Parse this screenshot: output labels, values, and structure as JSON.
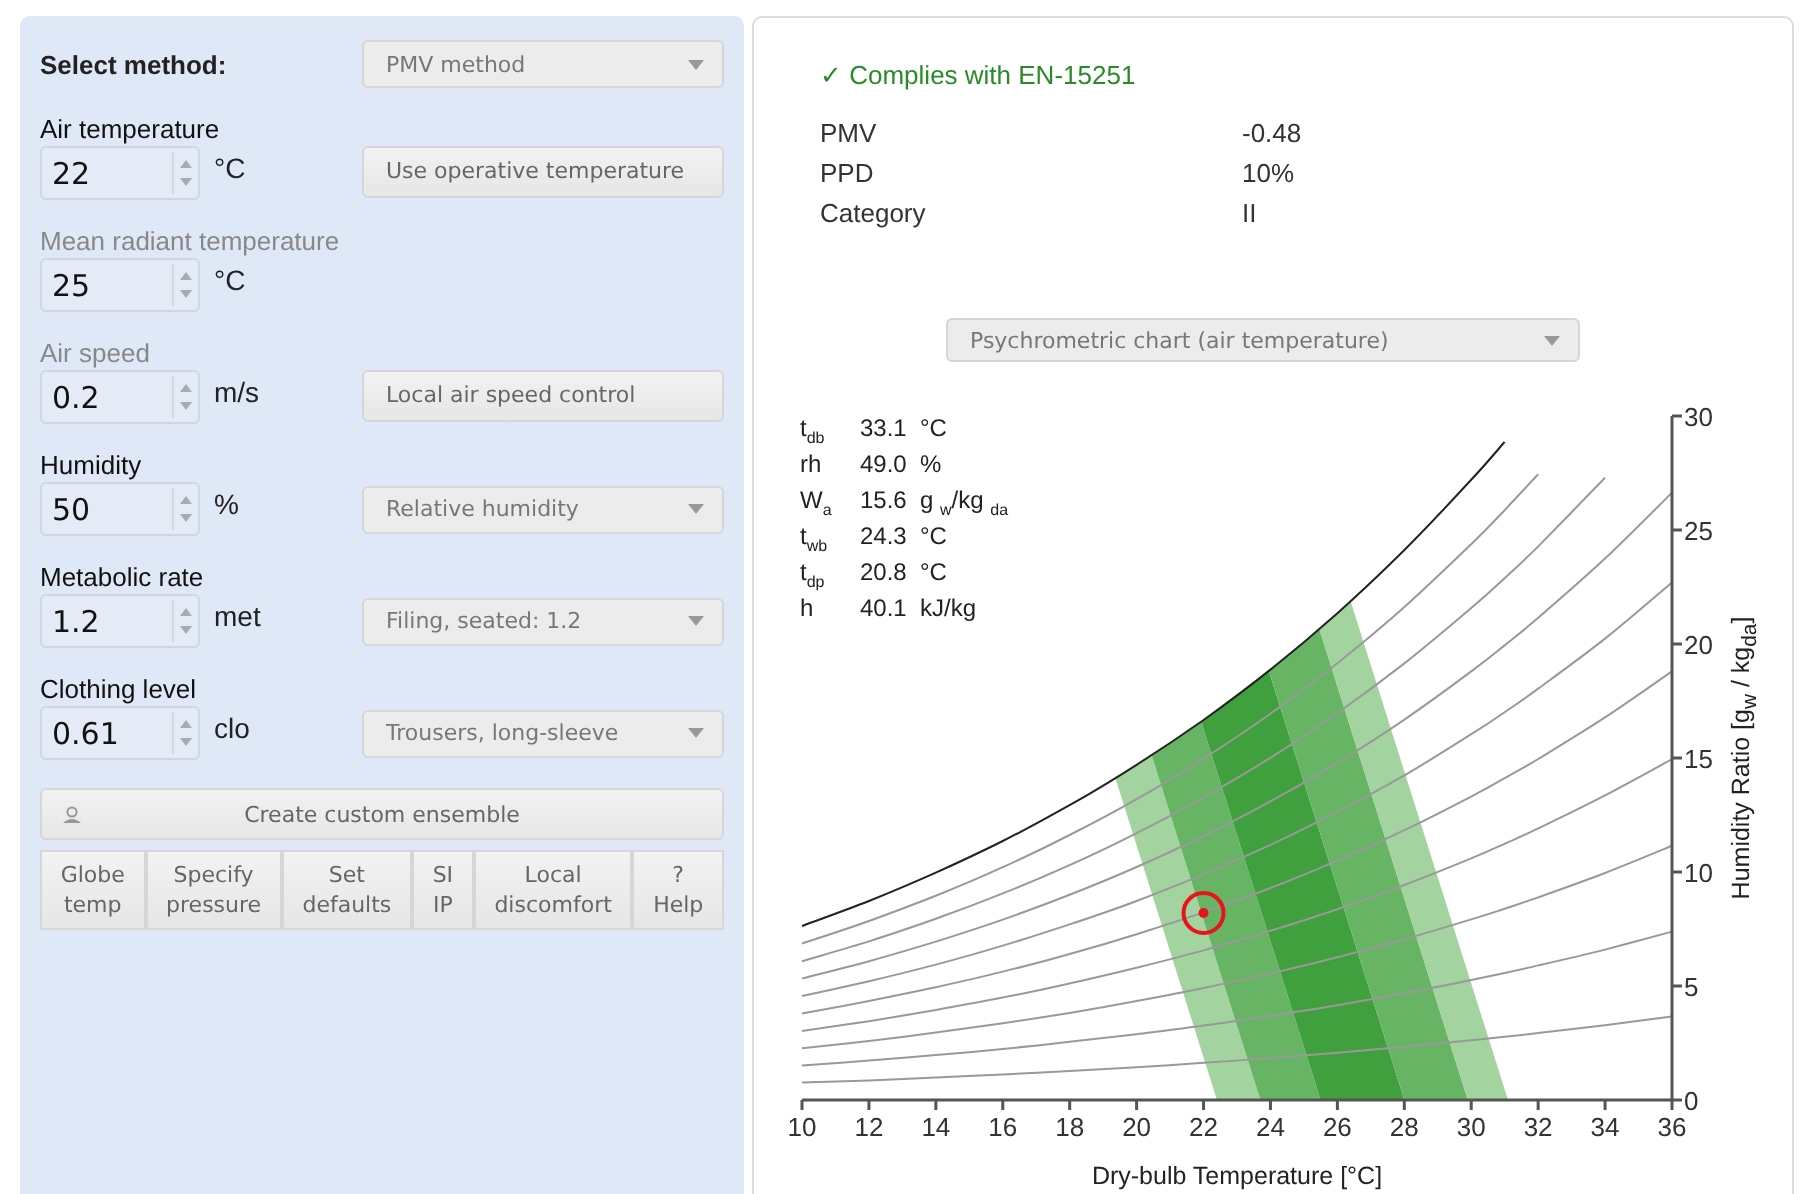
{
  "method": {
    "label": "Select method:",
    "value": "PMV method"
  },
  "fields": [
    {
      "label": "Air temperature",
      "muted_label": false,
      "value": "22",
      "unit": "°C",
      "control": {
        "kind": "button",
        "label": "Use operative temperature"
      }
    },
    {
      "label": "Mean radiant temperature",
      "muted_label": true,
      "value": "25",
      "unit": "°C"
    },
    {
      "label": "Air speed",
      "muted_label": true,
      "value": "0.2",
      "unit": "m/s",
      "control": {
        "kind": "button",
        "label": "Local air speed control"
      }
    },
    {
      "label": "Humidity",
      "muted_label": false,
      "value": "50",
      "unit": "%",
      "control": {
        "kind": "select",
        "label": "Relative humidity"
      }
    },
    {
      "label": "Metabolic rate",
      "muted_label": false,
      "value": "1.2",
      "unit": "met",
      "control": {
        "kind": "select",
        "label": "Filing, seated: 1.2"
      }
    },
    {
      "label": "Clothing level",
      "muted_label": false,
      "value": "0.61",
      "unit": "clo",
      "control": {
        "kind": "select",
        "label": "Trousers, long-sleeve"
      }
    }
  ],
  "ensemble_button": "Create custom ensemble",
  "tool_buttons": [
    [
      "Globe",
      "temp"
    ],
    [
      "Specify",
      "pressure"
    ],
    [
      "Set",
      "defaults"
    ],
    [
      "SI",
      "IP"
    ],
    [
      "Local",
      "discomfort"
    ],
    [
      "?",
      "Help"
    ]
  ],
  "compliance": {
    "mark": "✓",
    "text": "Complies with EN-15251",
    "ok": true
  },
  "results": [
    {
      "label": "PMV",
      "value": "-0.48"
    },
    {
      "label": "PPD",
      "value": "10%"
    },
    {
      "label": "Category",
      "value": "II"
    }
  ],
  "chart_select": "Psychrometric chart (air temperature)",
  "readouts": [
    {
      "symbol": "t$_{db}$",
      "value": "33.1",
      "unit": "°C"
    },
    {
      "symbol": "rh",
      "value": "49.0",
      "unit": "%"
    },
    {
      "symbol": "W$_{a}$",
      "value": "15.6",
      "unit": "g $_{w}$/kg $_{da}$"
    },
    {
      "symbol": "t$_{wb}$",
      "value": "24.3",
      "unit": "°C"
    },
    {
      "symbol": "t$_{dp}$",
      "value": "20.8",
      "unit": "°C"
    },
    {
      "symbol": "h",
      "value": "40.1",
      "unit": "kJ/kg"
    }
  ],
  "chart_data": {
    "type": "line",
    "xlabel": "Dry-bulb Temperature [°C]",
    "ylabel": "Humidity Ratio [g$_{w}$ / kg$_{da}$]",
    "xlim": [
      10,
      36
    ],
    "ylim": [
      0,
      30
    ],
    "xticks": [
      10,
      12,
      14,
      16,
      18,
      20,
      22,
      24,
      26,
      28,
      30,
      32,
      34,
      36
    ],
    "yticks": [
      0,
      5,
      10,
      15,
      20,
      25,
      30
    ],
    "x": [
      10,
      12,
      14,
      16,
      18,
      20,
      22,
      24,
      26,
      28,
      30,
      31,
      32,
      34,
      36
    ],
    "series": [
      {
        "color": "#999999",
        "values": [
          0.76,
          0.86,
          0.98,
          1.12,
          1.27,
          1.44,
          1.63,
          1.84,
          2.07,
          2.33,
          2.62,
          2.77,
          2.94,
          3.28,
          3.67
        ]
      },
      {
        "color": "#999999",
        "values": [
          1.51,
          1.73,
          1.97,
          2.24,
          2.55,
          2.89,
          3.26,
          3.69,
          4.16,
          4.68,
          5.26,
          5.57,
          5.9,
          6.6,
          7.39
        ]
      },
      {
        "color": "#999999",
        "values": [
          2.27,
          2.59,
          2.96,
          3.37,
          3.82,
          4.34,
          4.91,
          5.55,
          6.26,
          7.05,
          7.92,
          8.39,
          8.89,
          9.96,
          11.15
        ]
      },
      {
        "color": "#999999",
        "values": [
          3.03,
          3.46,
          3.95,
          4.49,
          5.11,
          5.8,
          6.56,
          7.42,
          8.37,
          9.43,
          10.6,
          11.24,
          11.91,
          13.36,
          14.95
        ]
      },
      {
        "color": "#999999",
        "values": [
          3.79,
          4.34,
          4.95,
          5.63,
          6.4,
          7.27,
          8.23,
          9.3,
          10.5,
          11.83,
          13.31,
          14.11,
          14.96,
          16.78,
          18.8
        ]
      },
      {
        "color": "#999999",
        "values": [
          4.56,
          5.21,
          5.94,
          6.77,
          7.7,
          8.73,
          9.9,
          11.19,
          12.64,
          14.24,
          16.04,
          17.01,
          18.04,
          20.24,
          22.7
        ]
      },
      {
        "color": "#999999",
        "values": [
          5.33,
          6.09,
          6.95,
          7.91,
          9.0,
          10.22,
          11.58,
          13.1,
          14.79,
          16.68,
          18.8,
          19.94,
          21.15,
          23.75,
          26.64
        ]
      },
      {
        "color": "#999999",
        "values": [
          6.09,
          6.96,
          7.95,
          9.06,
          10.3,
          11.7,
          13.27,
          15.01,
          16.97,
          19.15,
          21.58,
          22.89,
          24.28,
          27.29,
          null
        ]
      },
      {
        "color": "#999999",
        "values": [
          6.86,
          7.85,
          8.96,
          10.21,
          11.62,
          13.19,
          14.97,
          16.94,
          19.16,
          21.62,
          24.38,
          25.87,
          27.45,
          null,
          null
        ]
      },
      {
        "color": "#222222",
        "values": [
          7.63,
          8.73,
          9.97,
          11.36,
          12.93,
          14.7,
          16.67,
          18.88,
          21.35,
          24.12,
          27.2,
          28.87,
          null,
          null,
          null
        ]
      },
      {
        "color": "#e8141a",
        "marker": "circle",
        "values": [
          null,
          null,
          null,
          null,
          null,
          null,
          8.2,
          null,
          null,
          null,
          null,
          null,
          null,
          null,
          null
        ]
      }
    ]
  }
}
